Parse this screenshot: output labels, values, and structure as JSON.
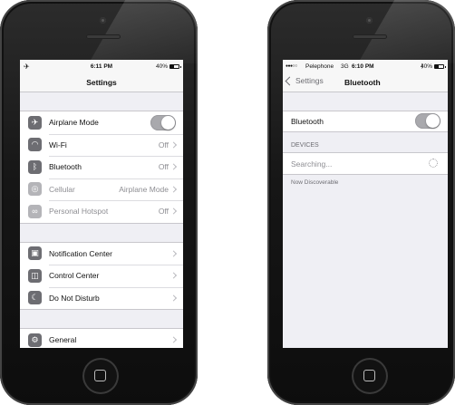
{
  "left_phone": {
    "status_bar": {
      "airplane": "✈",
      "time": "6:11 PM",
      "battery": "40%"
    },
    "title": "Settings",
    "groups": [
      [
        {
          "label": "Airplane Mode",
          "icon": "airplane-icon",
          "glyph": "✈",
          "toggle": true
        },
        {
          "label": "Wi-Fi",
          "icon": "wifi-icon",
          "glyph": "◠",
          "value": "Off"
        },
        {
          "label": "Bluetooth",
          "icon": "bluetooth-icon",
          "glyph": "ᛒ",
          "value": "Off"
        },
        {
          "label": "Cellular",
          "icon": "cellular-icon",
          "glyph": "◎",
          "value": "Airplane Mode",
          "disabled": true
        },
        {
          "label": "Personal Hotspot",
          "icon": "hotspot-icon",
          "glyph": "∞",
          "value": "Off",
          "disabled": true
        }
      ],
      [
        {
          "label": "Notification Center",
          "icon": "notification-center-icon",
          "glyph": "▣"
        },
        {
          "label": "Control Center",
          "icon": "control-center-icon",
          "glyph": "◫"
        },
        {
          "label": "Do Not Disturb",
          "icon": "moon-icon",
          "glyph": "☾"
        }
      ],
      [
        {
          "label": "General",
          "icon": "gear-icon",
          "glyph": "⚙"
        }
      ]
    ]
  },
  "right_phone": {
    "status_bar": {
      "signal": "●●●○○",
      "carrier": "Pelephone",
      "network": "3G",
      "time": "6:10 PM",
      "bt_glyph": "ᛒ",
      "battery": "40%"
    },
    "back_label": "Settings",
    "title": "Bluetooth",
    "bluetooth_row": "Bluetooth",
    "devices_header": "DEVICES",
    "searching": "Searching...",
    "discoverable": "Now Discoverable"
  },
  "colors": {
    "screen_bg": "#efeff4",
    "icon_gray": "#6d6d72",
    "toggle_off": "#a9a9ad"
  }
}
